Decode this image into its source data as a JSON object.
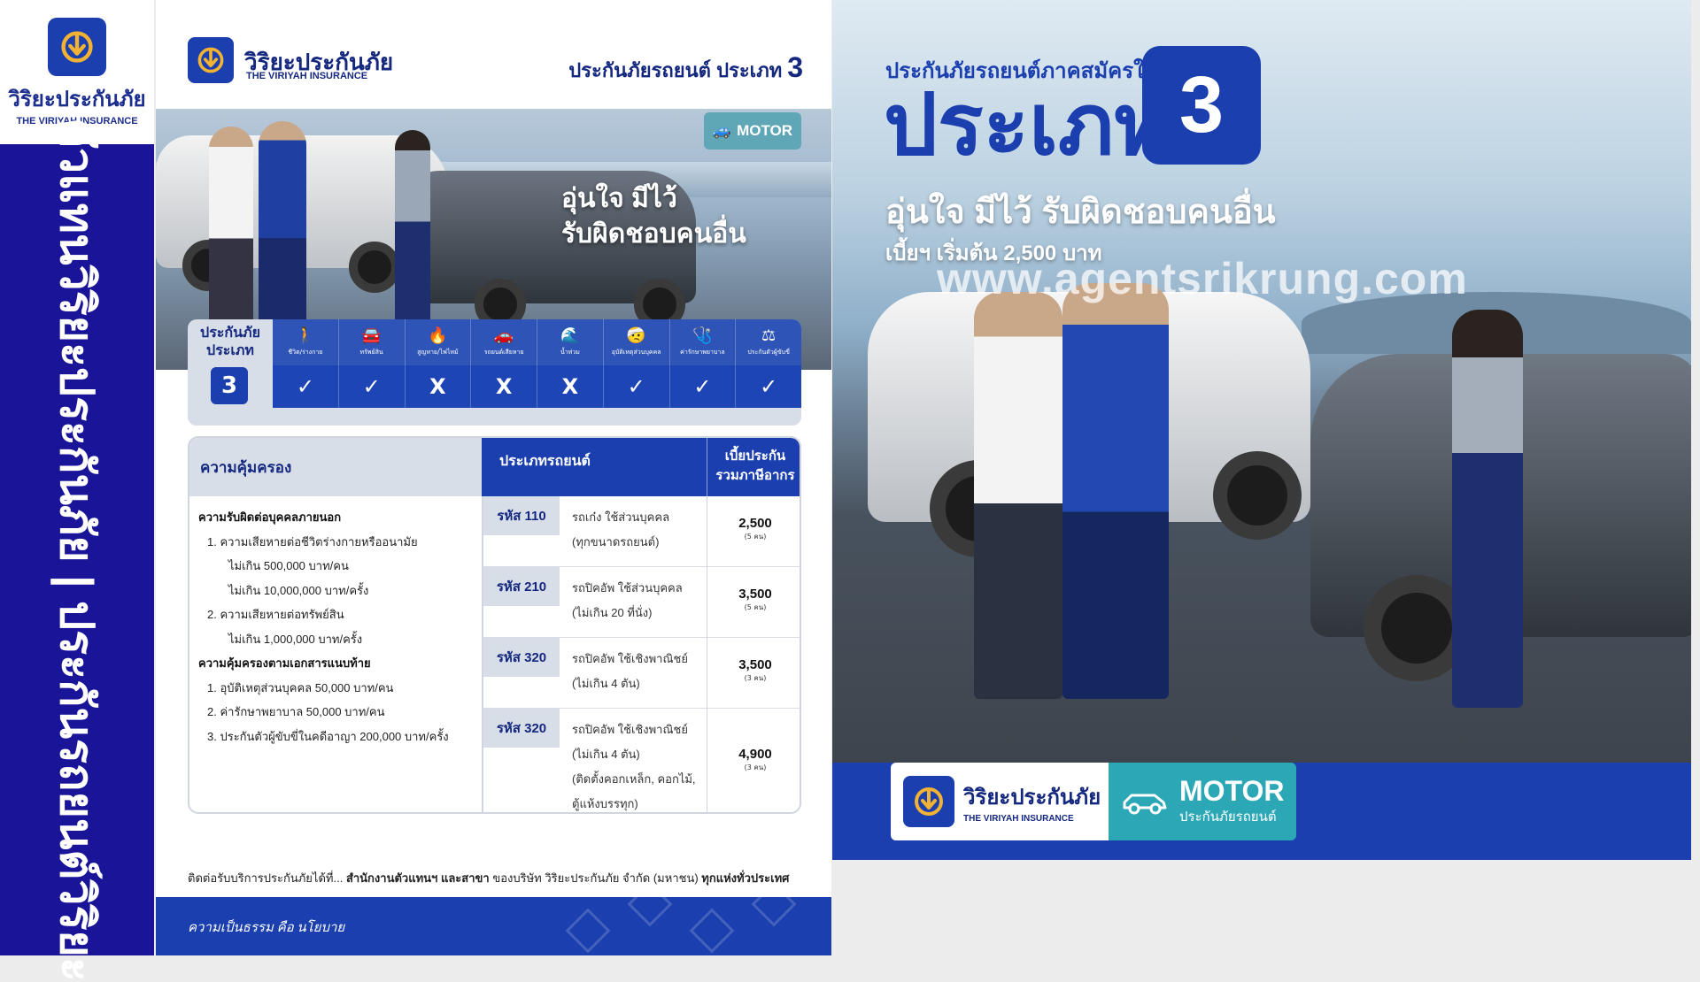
{
  "left_strip": {
    "brand_th": "วิริยะประกันภัย",
    "brand_en": "THE VIRIYAH INSURANCE",
    "vertical_title": "ตัวแทนวิริยะประกันภัย | ประกันรถยนต์วิริยะ",
    "logo_icon": "viriyah-logo-icon"
  },
  "brochure": {
    "brand_th": "วิริยะประกันภัย",
    "brand_en": "THE VIRIYAH INSURANCE",
    "type_title": "ประกันภัยรถยนต์ ประเภท",
    "type_number": "3",
    "motor_badge": "MOTOR",
    "motor_badge_sub": "ประกันภัยรถยนต์",
    "slogan_line1": "อุ่นใจ มีไว้",
    "slogan_line2": "รับผิดชอบคนอื่น",
    "coverage_strip": {
      "label_line1": "ประกันภัย",
      "label_line2": "ประเภท",
      "number": "3",
      "items": [
        {
          "caption": "ชีวิต/ร่างกาย",
          "icon": "person-icon",
          "mark": "✓"
        },
        {
          "caption": "ทรัพย์สิน",
          "icon": "property-icon",
          "mark": "✓"
        },
        {
          "caption": "สูญหาย/ไฟไหม้",
          "icon": "fire-theft-icon",
          "mark": "X"
        },
        {
          "caption": "รถยนต์เสียหาย",
          "icon": "car-damage-icon",
          "mark": "X"
        },
        {
          "caption": "น้ำท่วม",
          "icon": "flood-icon",
          "mark": "X"
        },
        {
          "caption": "อุบัติเหตุส่วนบุคคล",
          "icon": "accident-icon",
          "mark": "✓"
        },
        {
          "caption": "ค่ารักษาพยาบาล",
          "icon": "medical-icon",
          "mark": "✓"
        },
        {
          "caption": "ประกันตัวผู้ขับขี่",
          "icon": "bail-icon",
          "mark": "✓"
        }
      ]
    },
    "table": {
      "header_coverage": "ความคุ้มครอง",
      "header_type": "ประเภทรถยนต์",
      "header_premium_line1": "เบี้ยประกัน",
      "header_premium_line2": "รวมภาษีอากร",
      "coverage_lines": [
        {
          "text": "ความรับผิดต่อบุคคลภายนอก",
          "level": "h"
        },
        {
          "text": "1. ความเสียหายต่อชีวิตร่างกายหรืออนามัย",
          "level": "i1"
        },
        {
          "text": "ไม่เกิน 500,000 บาท/คน",
          "level": "i2"
        },
        {
          "text": "ไม่เกิน 10,000,000 บาท/ครั้ง",
          "level": "i2"
        },
        {
          "text": "2. ความเสียหายต่อทรัพย์สิน",
          "level": "i1"
        },
        {
          "text": "ไม่เกิน 1,000,000 บาท/ครั้ง",
          "level": "i2"
        },
        {
          "text": "ความคุ้มครองตามเอกสารแนบท้าย",
          "level": "h"
        },
        {
          "text": "1. อุบัติเหตุส่วนบุคคล 50,000 บาท/คน",
          "level": "i1"
        },
        {
          "text": "2. ค่ารักษาพยาบาล 50,000 บาท/คน",
          "level": "i1"
        },
        {
          "text": "3. ประกันตัวผู้ขับขี่ในคดีอาญา 200,000 บาท/ครั้ง",
          "level": "i1"
        }
      ],
      "rows": [
        {
          "code": "รหัส 110",
          "desc1": "รถเก๋ง ใช้ส่วนบุคคล",
          "desc2": "(ทุกขนาดรถยนต์)",
          "desc3": "",
          "desc4": "",
          "price": "2,500",
          "seats": "(5 คน)"
        },
        {
          "code": "รหัส 210",
          "desc1": "รถปิคอัพ ใช้ส่วนบุคคล",
          "desc2": "(ไม่เกิน 20 ที่นั่ง)",
          "desc3": "",
          "desc4": "",
          "price": "3,500",
          "seats": "(5 คน)"
        },
        {
          "code": "รหัส 320",
          "desc1": "รถปิคอัพ ใช้เชิงพาณิชย์",
          "desc2": "(ไม่เกิน 4 ตัน)",
          "desc3": "",
          "desc4": "",
          "price": "3,500",
          "seats": "(3 คน)"
        },
        {
          "code": "รหัส 320",
          "desc1": "รถปิคอัพ ใช้เชิงพาณิชย์",
          "desc2": "(ไม่เกิน 4 ตัน)",
          "desc3": "(ติดตั้งคอกเหล็ก, คอกไม้,",
          "desc4": "ตู้แห้งบรรทุก)",
          "price": "4,900",
          "seats": "(3 คน)"
        }
      ]
    },
    "contact_prefix": "ติดต่อรับบริการประกันภัยได้ที่...",
    "contact_bold1": "สำนักงานตัวแทนฯ และสาขา",
    "contact_mid": "ของบริษัท วิริยะประกันภัย จำกัด (มหาชน)",
    "contact_bold2": "ทุกแห่งทั่วประเทศ",
    "footer_text": "ความเป็นธรรม คือ นโยบาย"
  },
  "ad": {
    "kicker": "ประกันภัยรถยนต์ภาคสมัครใจ",
    "type_word": "ประเภท",
    "type_number": "3",
    "slogan": "อุ่นใจ มีไว้ รับผิดชอบคนอื่น",
    "price_text": "เบี้ยฯ เริ่มต้น 2,500 บาท",
    "watermark": "www.agentsrikrung.com",
    "logo_th": "วิริยะประกันภัย",
    "logo_en": "THE VIRIYAH INSURANCE",
    "motor": "MOTOR",
    "motor_sub": "ประกันภัยรถยนต์"
  },
  "colors": {
    "brand_blue": "#1b3fae",
    "deep_blue": "#1a1598",
    "teal": "#2ca7b6",
    "gold": "#f2b233"
  }
}
